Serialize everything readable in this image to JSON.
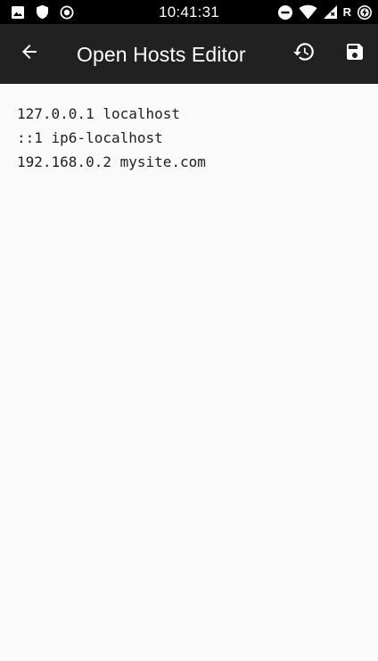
{
  "status_bar": {
    "time": "10:41:31",
    "left_icons": [
      "image-icon",
      "shield-icon",
      "record-icon"
    ],
    "right_icons": [
      "do-not-disturb-icon",
      "wifi-icon",
      "cell-signal-icon",
      "battery-charging-icon"
    ],
    "roaming_indicator": "R"
  },
  "app_bar": {
    "title": "Open Hosts Editor",
    "background": "#212121"
  },
  "editor": {
    "lines": [
      "127.0.0.1 localhost",
      "::1 ip6-localhost",
      "192.168.0.2 mysite.com"
    ]
  }
}
